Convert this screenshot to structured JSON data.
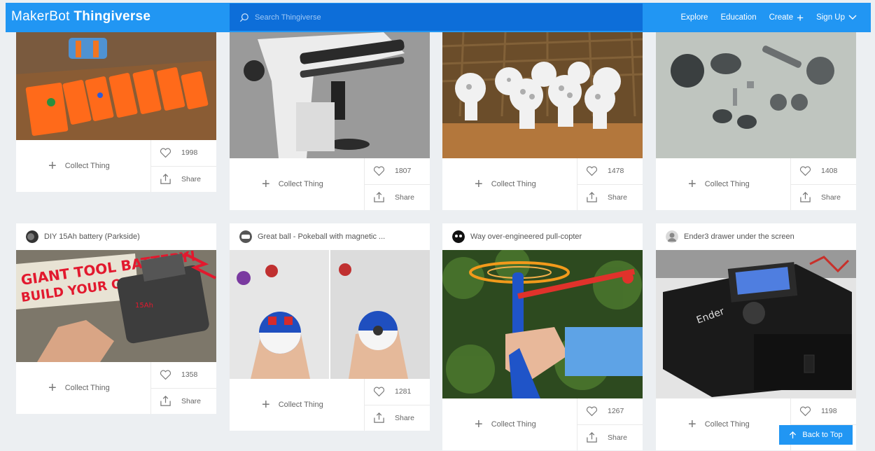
{
  "header": {
    "logo_left": "MakerBot",
    "logo_right": "Thingiverse",
    "search_placeholder": "Search Thingiverse",
    "nav": {
      "explore": "Explore",
      "education": "Education",
      "create": "Create",
      "signup": "Sign Up"
    }
  },
  "labels": {
    "collect": "Collect Thing",
    "share": "Share"
  },
  "row1": [
    {
      "likes": "1998"
    },
    {
      "likes": "1807"
    },
    {
      "likes": "1478"
    },
    {
      "likes": "1408"
    }
  ],
  "row2": [
    {
      "title": "DIY 15Ah battery (Parkside)",
      "likes": "1358",
      "image_text_1": "GIANT TOOL BATTERY!",
      "image_text_2": "BUILD YOUR OWN!",
      "image_text_3": "15Ah"
    },
    {
      "title": "Great ball - Pokeball with magnetic ...",
      "likes": "1281"
    },
    {
      "title": "Way over-engineered pull-copter",
      "likes": "1267"
    },
    {
      "title": "Ender3 drawer under the screen",
      "likes": "1198",
      "image_text_1": "Ender"
    }
  ],
  "back_to_top": "Back to Top",
  "colors": {
    "header": "#2196f3",
    "search": "#0d6ed9",
    "page_bg": "#eceff2"
  }
}
